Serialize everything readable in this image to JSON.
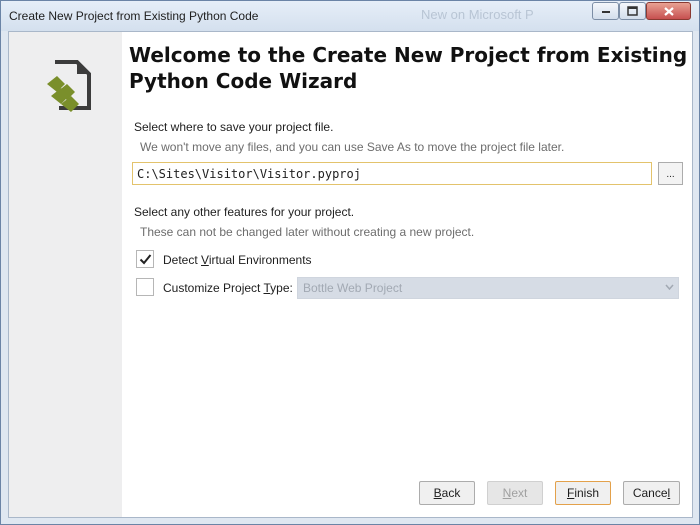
{
  "window": {
    "title": "Create New Project from Existing Python Code",
    "background_text": "New on Microsoft P"
  },
  "icons": {
    "logo": "python-code-file-icon",
    "minimize": "minimize-icon",
    "maximize": "maximize-icon",
    "close": "close-icon",
    "dropdown": "chevron-down-icon",
    "checkmark": "checkmark-icon"
  },
  "wizard": {
    "heading": "Welcome to the Create New Project from Existing Python Code Wizard",
    "save_section": {
      "label": "Select where to save your project file.",
      "hint": "We won't move any files, and you can use Save As to move the project file later.",
      "path_value": "C:\\Sites\\Visitor\\Visitor.pyproj",
      "browse_label": "..."
    },
    "features_section": {
      "label": "Select any other features for your project.",
      "hint": "These can not be changed later without creating a new project.",
      "detect_env": {
        "label_pre": "Detect ",
        "label_key": "V",
        "label_post": "irtual Environments",
        "checked": true
      },
      "customize_type": {
        "label_pre": "Customize Project ",
        "label_key": "T",
        "label_post": "ype:",
        "checked": false,
        "selected": "Bottle Web Project"
      }
    }
  },
  "buttons": {
    "back": {
      "key": "B",
      "rest": "ack"
    },
    "next": {
      "key": "N",
      "rest": "ext"
    },
    "finish": {
      "key": "F",
      "rest": "inish"
    },
    "cancel": {
      "pre": "Cance",
      "key": "l"
    }
  },
  "colors": {
    "accent_border": "#e3c36c",
    "logo_green": "#7a8f2b",
    "logo_dark": "#3c3c3c"
  }
}
